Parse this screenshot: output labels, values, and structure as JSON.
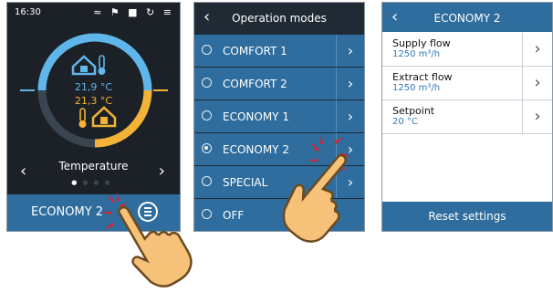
{
  "screen1": {
    "status_time": "16:30",
    "status_icons": "≈ ⚑ ■ ↻ ≡",
    "indoor_temp": "21,9 °C",
    "outdoor_temp": "21,3 °C",
    "label": "Temperature",
    "left_arrow": "‹",
    "right_arrow": "›",
    "mode": "ECONOMY 2",
    "colors": {
      "indoor": "#5fb6ea",
      "outdoor": "#f2b336",
      "bar": "#2e6d9e"
    }
  },
  "screen2": {
    "back_arrow": "‹",
    "title": "Operation modes",
    "modes": [
      {
        "label": "COMFORT 1",
        "selected": false
      },
      {
        "label": "COMFORT 2",
        "selected": false
      },
      {
        "label": "ECONOMY 1",
        "selected": false
      },
      {
        "label": "ECONOMY 2",
        "selected": true
      },
      {
        "label": "SPECIAL",
        "selected": false
      },
      {
        "label": "OFF",
        "selected": false
      }
    ],
    "chevron": "›"
  },
  "screen3": {
    "back_arrow": "‹",
    "title": "ECONOMY 2",
    "settings": [
      {
        "name": "Supply flow",
        "value": "1250 m³/h"
      },
      {
        "name": "Extract flow",
        "value": "1250 m³/h"
      },
      {
        "name": "Setpoint",
        "value": "20 °C"
      }
    ],
    "chevron": "›",
    "reset_label": "Reset settings"
  }
}
